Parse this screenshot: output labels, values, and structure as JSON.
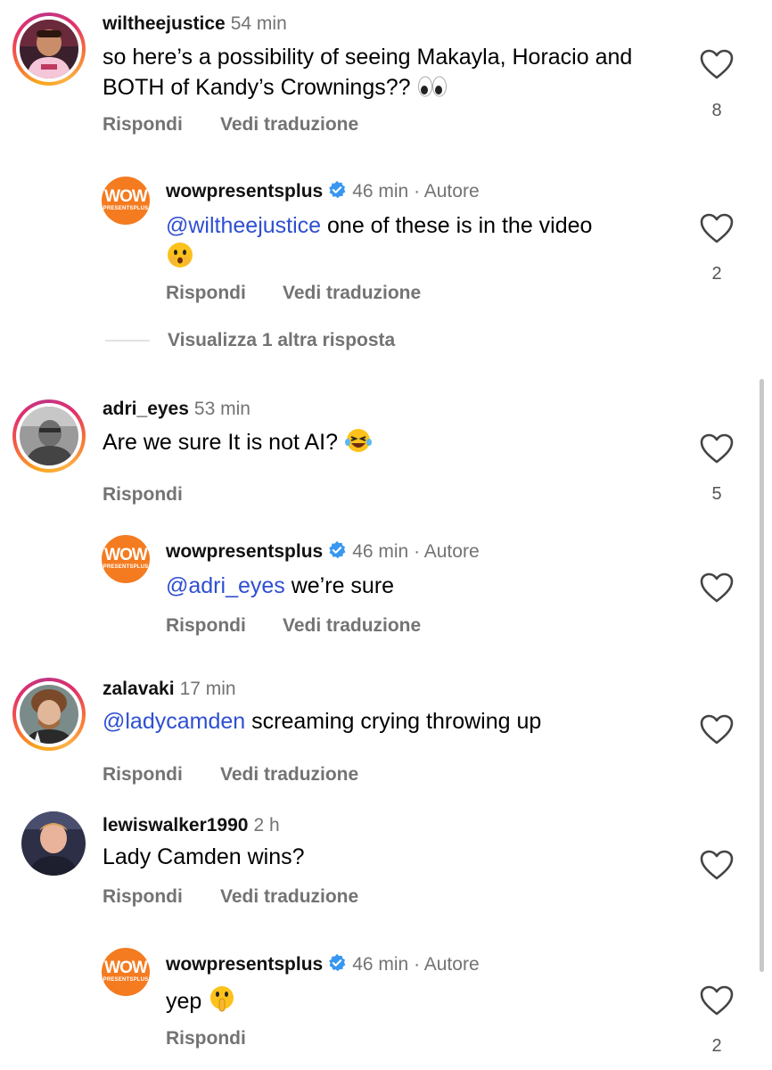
{
  "comments": [
    {
      "username": "wiltheejustice",
      "time": "54 min",
      "text": "so here’s a possibility of seeing Makayla, Horacio and BOTH of Kandy’s Crownings??",
      "reply_label": "Rispondi",
      "translate_label": "Vedi traduzione",
      "likes": "8",
      "replies": [
        {
          "username": "wowpresentsplus",
          "time": "46 min",
          "author_label": "· Autore",
          "mention": "@wiltheejustice",
          "text": " one of these is in the video",
          "reply_label": "Rispondi",
          "translate_label": "Vedi traduzione",
          "likes": "2"
        }
      ],
      "more_replies_label": "Visualizza 1 altra risposta"
    },
    {
      "username": "adri_eyes",
      "time": "53 min",
      "text": "Are we sure It is not AI?",
      "reply_label": "Rispondi",
      "likes": "5",
      "replies": [
        {
          "username": "wowpresentsplus",
          "time": "46 min",
          "author_label": "· Autore",
          "mention": "@adri_eyes",
          "text": " we’re sure",
          "reply_label": "Rispondi",
          "translate_label": "Vedi traduzione"
        }
      ]
    },
    {
      "username": "zalavaki",
      "time": "17 min",
      "mention": "@ladycamden",
      "text": " screaming crying throwing up",
      "reply_label": "Rispondi",
      "translate_label": "Vedi traduzione"
    },
    {
      "username": "lewiswalker1990",
      "time": "2 h",
      "text": "Lady Camden wins?",
      "reply_label": "Rispondi",
      "translate_label": "Vedi traduzione",
      "replies": [
        {
          "username": "wowpresentsplus",
          "time": "46 min",
          "author_label": "· Autore",
          "text": "yep",
          "reply_label": "Rispondi",
          "likes": "2"
        }
      ]
    }
  ],
  "logo": {
    "main": "WOW",
    "sub": "PRESENTSPLUS"
  },
  "colors": {
    "mention": "#2e4fd1",
    "muted": "#737373",
    "verified": "#3897f0",
    "wow_orange": "#f47b20"
  },
  "icons": [
    "heart-icon",
    "verified-icon",
    "eyes-emoji",
    "laughing-emoji",
    "face-with-hand-emoji",
    "shushing-emoji"
  ]
}
